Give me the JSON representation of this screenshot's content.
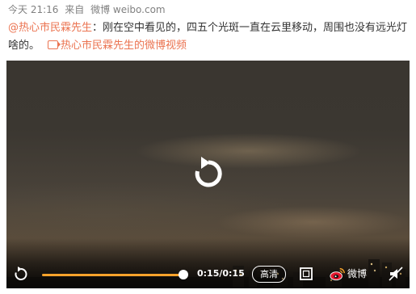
{
  "meta": {
    "time": "今天 21:16",
    "source_prefix": "来自",
    "source": "微博 weibo.com"
  },
  "post": {
    "mention": "@热心市民霖先生",
    "text": "：刚在空中看见的，四五个光斑一直在云里移动，周围也没有远光灯啥的。",
    "video_link": "热心市民霖先生的微博视频"
  },
  "player": {
    "time_display": "0:15/0:15",
    "progress": 1.0,
    "quality_label": "高清",
    "brand_label": "微博",
    "icons": {
      "replay_big": "replay-icon",
      "replay_small": "replay-icon",
      "fullscreen": "fullscreen-icon",
      "brand": "weibo-logo-icon",
      "mute": "mute-icon"
    },
    "colors": {
      "progress": "#f7a32b",
      "link": "#eb7350"
    }
  }
}
